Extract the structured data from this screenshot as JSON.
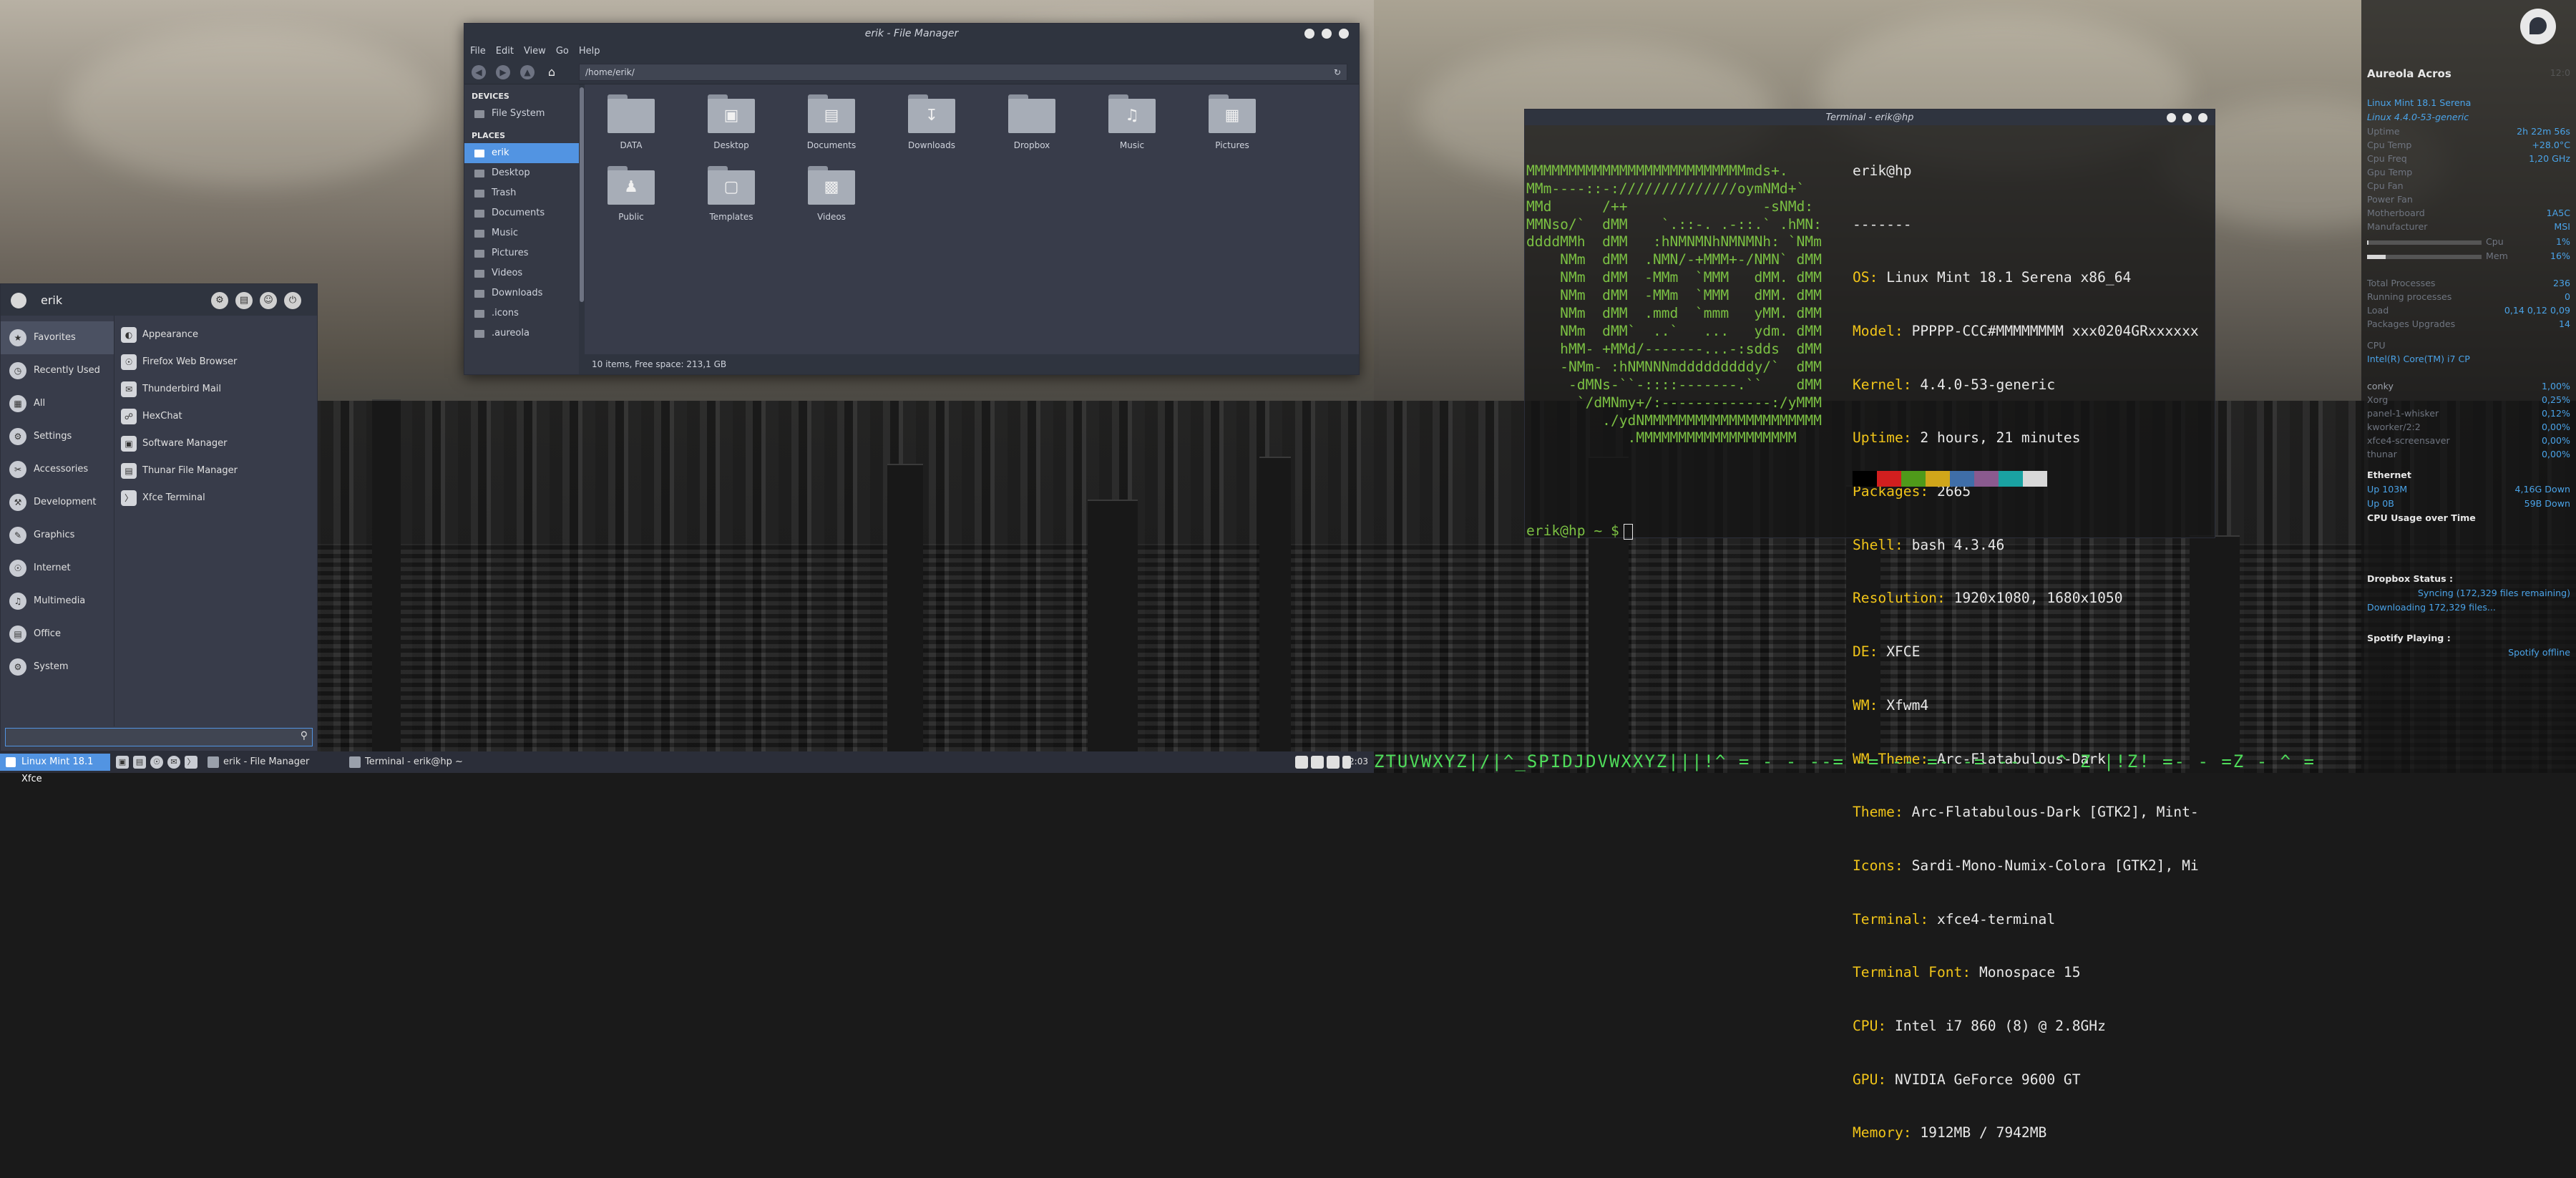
{
  "file_manager": {
    "title": "erik - File Manager",
    "menu": [
      "File",
      "Edit",
      "View",
      "Go",
      "Help"
    ],
    "address": "/home/erik/",
    "devices_header": "DEVICES",
    "devices": [
      "File System"
    ],
    "places_header": "PLACES",
    "places": [
      "erik",
      "Desktop",
      "Trash",
      "Documents",
      "Music",
      "Pictures",
      "Videos",
      "Downloads",
      ".icons",
      ".aureola"
    ],
    "folders": [
      "DATA",
      "Desktop",
      "Documents",
      "Downloads",
      "Dropbox",
      "Music",
      "Pictures",
      "Public",
      "Templates",
      "Videos"
    ],
    "status": "10 items, Free space: 213,1 GB"
  },
  "whisker_menu": {
    "username": "erik",
    "categories": [
      "Favorites",
      "Recently Used",
      "All",
      "Settings",
      "Accessories",
      "Development",
      "Graphics",
      "Internet",
      "Multimedia",
      "Office",
      "System"
    ],
    "apps": [
      "Appearance",
      "Firefox Web Browser",
      "Thunderbird Mail",
      "HexChat",
      "Software Manager",
      "Thunar File Manager",
      "Xfce Terminal"
    ],
    "search_value": ""
  },
  "terminal": {
    "title": "Terminal - erik@hp",
    "art": [
      "MMMMMMMMMMMMMMMMMMMMMMMMMMmds+.",
      "MMm----::-://////////////oymNMd+`",
      "MMd      /++                -sNMd:",
      "MMNso/`  dMM    `.::-. .-::.` .hMN:",
      "ddddMMh  dMM   :hNMNMNhNMNMNh: `NMm",
      "    NMm  dMM  .NMN/-+MMM+-/NMN` dMM",
      "    NMm  dMM  -MMm  `MMM   dMM. dMM",
      "    NMm  dMM  -MMm  `MMM   dMM. dMM",
      "    NMm  dMM  .mmd  `mmm   yMM. dMM",
      "    NMm  dMM`  ..`   ...   ydm. dMM",
      "    hMM- +MMd/-------...-:sdds  dMM",
      "    -NMm- :hNMNNNmdddddddddy/`  dMM",
      "     -dMNs-``-::::-------.``    dMM",
      "      `/dMNmy+/:-------------:/yMMM",
      "         ./ydNMMMMMMMMMMMMMMMMMMMMM",
      "            .MMMMMMMMMMMMMMMMMMM"
    ],
    "user_host": "erik@hp",
    "separator": "-------",
    "info": [
      {
        "key": "OS:",
        "value": "Linux Mint 18.1 Serena x86_64"
      },
      {
        "key": "Model:",
        "value": "PPPPP-CCC#MMMMMMMM xxx0204GRxxxxxx"
      },
      {
        "key": "Kernel:",
        "value": "4.4.0-53-generic"
      },
      {
        "key": "Uptime:",
        "value": "2 hours, 21 minutes"
      },
      {
        "key": "Packages:",
        "value": "2665"
      },
      {
        "key": "Shell:",
        "value": "bash 4.3.46"
      },
      {
        "key": "Resolution:",
        "value": "1920x1080, 1680x1050"
      },
      {
        "key": "DE:",
        "value": "XFCE"
      },
      {
        "key": "WM:",
        "value": "Xfwm4"
      },
      {
        "key": "WM Theme:",
        "value": "Arc-Flatabulous-Dark"
      },
      {
        "key": "Theme:",
        "value": "Arc-Flatabulous-Dark [GTK2], Mint-"
      },
      {
        "key": "Icons:",
        "value": "Sardi-Mono-Numix-Colora [GTK2], Mi"
      },
      {
        "key": "Terminal:",
        "value": "xfce4-terminal"
      },
      {
        "key": "Terminal Font:",
        "value": "Monospace 15"
      },
      {
        "key": "CPU:",
        "value": "Intel i7 860 (8) @ 2.8GHz"
      },
      {
        "key": "GPU:",
        "value": "NVIDIA GeForce 9600 GT"
      },
      {
        "key": "Memory:",
        "value": "1912MB / 7942MB"
      }
    ],
    "palette": [
      "#000000",
      "#d21f1f",
      "#4f9a1a",
      "#d0a61a",
      "#3f6ea8",
      "#8a5a8f",
      "#1aa2a2",
      "#d8d8d8"
    ],
    "prompt": "erik@hp ~ $"
  },
  "conky": {
    "title": "Aureola Acros",
    "title_right": "12:0",
    "distro": "Linux Mint 18.1 Serena",
    "kernel": "Linux 4.4.0-53-generic",
    "system": [
      {
        "label": "Uptime",
        "value": "2h 22m 56s"
      },
      {
        "label": "Cpu Temp",
        "value": "+28.0°C"
      },
      {
        "label": "Cpu Freq",
        "value": "1,20 GHz"
      },
      {
        "label": "Gpu Temp",
        "value": ""
      },
      {
        "label": "Cpu Fan",
        "value": ""
      },
      {
        "label": "Power Fan",
        "value": ""
      },
      {
        "label": "Motherboard",
        "value": "1A5C"
      },
      {
        "label": "Manufacturer",
        "value": "MSI"
      }
    ],
    "bars": [
      {
        "label": "Cpu",
        "value": "1%",
        "level": 0.01
      },
      {
        "label": "Mem",
        "value": "16%",
        "level": 0.16
      }
    ],
    "processes": [
      {
        "label": "Total Processes",
        "value": "236"
      },
      {
        "label": "Running processes",
        "value": "0"
      },
      {
        "label": "Load",
        "value": "0,14 0,12 0,09"
      },
      {
        "label": "Packages Upgrades",
        "value": "14"
      }
    ],
    "cpu_header": "CPU",
    "cpu_name": "Intel(R) Core(TM) i7 CP",
    "top": [
      {
        "name": "conky",
        "value": "1,00%"
      },
      {
        "name": "Xorg",
        "value": "0,25%"
      },
      {
        "name": "panel-1-whisker",
        "value": "0,12%"
      },
      {
        "name": "kworker/2:2",
        "value": "0,00%"
      },
      {
        "name": "xfce4-screensaver",
        "value": "0,00%"
      },
      {
        "name": "thunar",
        "value": "0,00%"
      }
    ],
    "net_header": "Ethernet",
    "net": [
      {
        "label": "Up 103M",
        "value": "4,16G Down"
      },
      {
        "label": "Up 0B",
        "value": "59B Down"
      }
    ],
    "cpu_graph_label": "CPU Usage over Time",
    "dropbox_label": "Dropbox Status :",
    "dropbox_status": "Syncing (172,329 files remaining)",
    "dropbox_detail": "Downloading 172,329 files...",
    "spotify_label": "Spotify Playing :",
    "spotify_status": "Spotify offline"
  },
  "panel": {
    "menu_label": "Linux Mint 18.1 Xfce",
    "tasks": [
      "erik - File Manager",
      "Terminal - erik@hp ~"
    ],
    "clock": "12:03"
  },
  "matrix_text": "ZTUVWXYZ|/|^_SPIDJDVWXXYZ|||!^ =  - - --=  -=  -- =- -= -- - ^ Z |!Z! =-  -   =Z -  ^  ="
}
